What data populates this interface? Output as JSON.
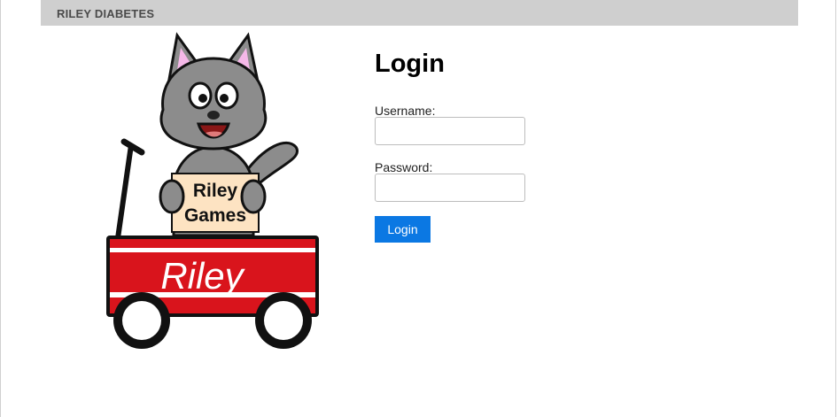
{
  "navbar": {
    "brand": "RILEY DIABETES"
  },
  "logo": {
    "sign_line1": "Riley",
    "sign_line2": "Games",
    "wagon_text": "Riley"
  },
  "login": {
    "title": "Login",
    "username_label": "Username:",
    "username_value": "",
    "password_label": "Password:",
    "password_value": "",
    "button_label": "Login"
  },
  "colors": {
    "navbar": "#cfcfcf",
    "button": "#0b78e3",
    "wagon_red": "#d9141c",
    "cat_gray": "#8c8c8c"
  }
}
